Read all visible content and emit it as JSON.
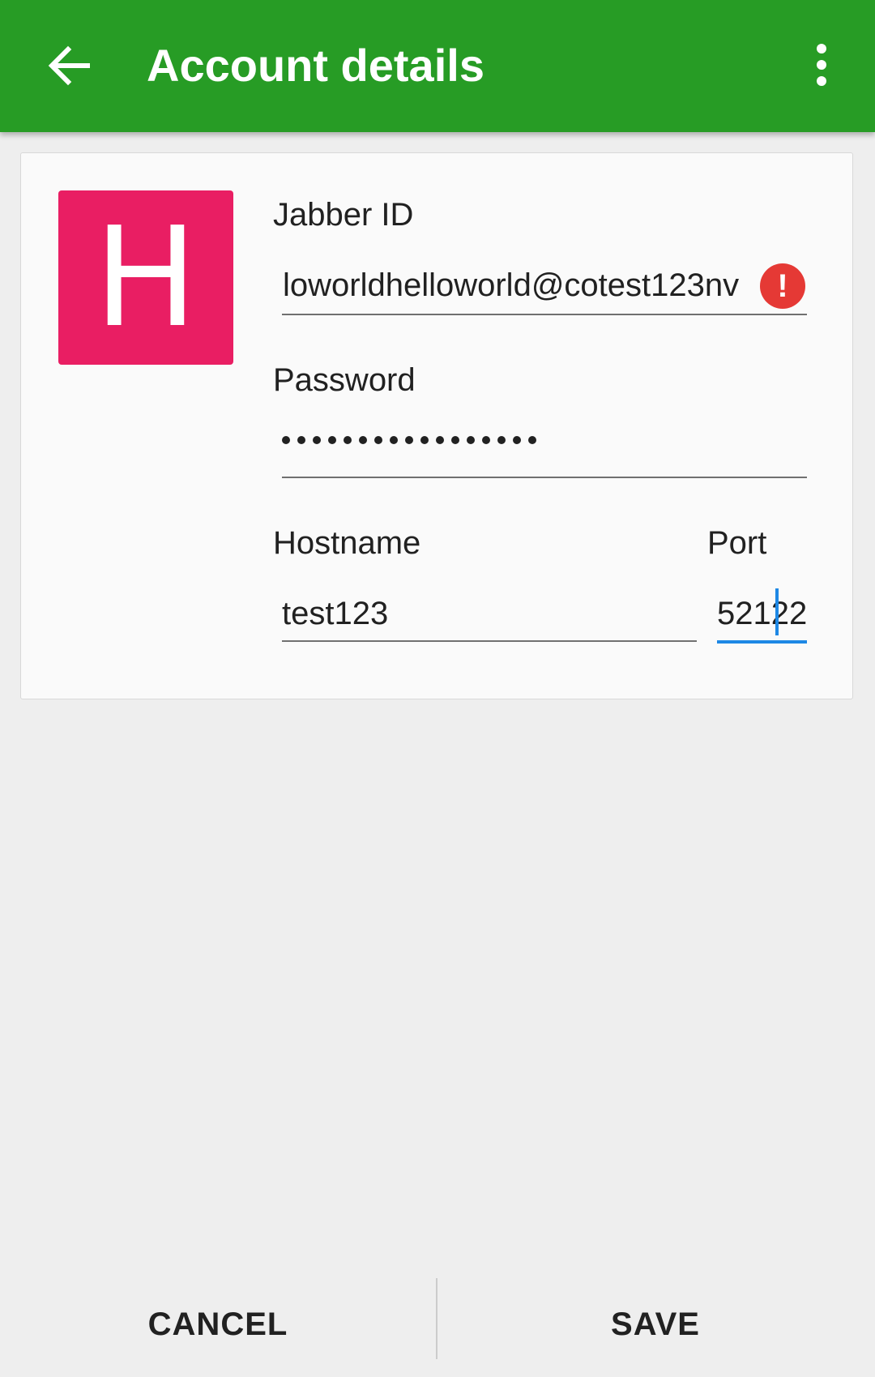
{
  "appbar": {
    "title": "Account details",
    "back_icon": "arrow-back-icon",
    "menu_icon": "more-vert-icon",
    "color": "#279c25"
  },
  "avatar": {
    "letter": "H",
    "color": "#e91e63"
  },
  "form": {
    "jabber_id": {
      "label": "Jabber ID",
      "value": "loworldhelloworld@cotest123nv",
      "error_icon": "error-icon",
      "error_glyph": "!"
    },
    "password": {
      "label": "Password",
      "masked_length": 17
    },
    "hostname": {
      "label": "Hostname",
      "value": "test123"
    },
    "port": {
      "label": "Port",
      "value": "52122"
    }
  },
  "actions": {
    "cancel_label": "CANCEL",
    "save_label": "SAVE"
  }
}
